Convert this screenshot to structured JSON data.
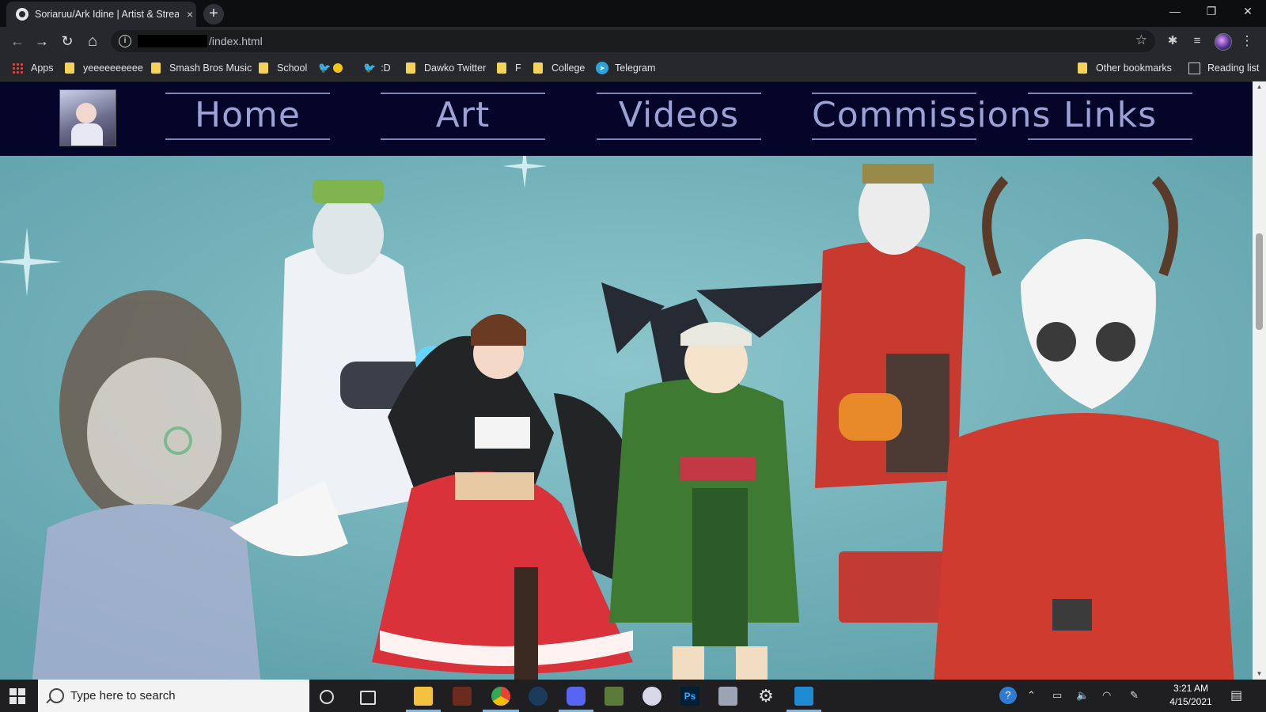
{
  "browser": {
    "tab_title": "Soriaruu/Ark Idine | Artist & Strea",
    "tab_close": "×",
    "new_tab": "+",
    "url_path": "/index.html",
    "window_controls": {
      "minimize": "—",
      "restore": "❐",
      "close": "✕"
    },
    "nav_icons": {
      "back": "←",
      "forward": "→",
      "reload": "↻",
      "home": "⌂",
      "bookmark_star": "☆",
      "extensions": "✱",
      "reading_queue": "≡",
      "menu": "⋮"
    }
  },
  "bookmarks": {
    "items": [
      {
        "label": "Apps",
        "icon": "apps-grid-icon"
      },
      {
        "label": "yeeeeeeeeee",
        "icon": "folder-icon"
      },
      {
        "label": "Smash Bros Music",
        "icon": "folder-icon"
      },
      {
        "label": "School",
        "icon": "folder-icon"
      },
      {
        "label": "",
        "icon": "twitter-icon"
      },
      {
        "label": ":D",
        "icon": "twitter-icon"
      },
      {
        "label": "Dawko Twitter",
        "icon": "folder-icon"
      },
      {
        "label": "F",
        "icon": "folder-icon"
      },
      {
        "label": "College",
        "icon": "folder-icon"
      },
      {
        "label": "Telegram",
        "icon": "telegram-icon"
      }
    ],
    "other": "Other bookmarks",
    "reading_list": "Reading list"
  },
  "site": {
    "nav": [
      "Home",
      "Art",
      "Videos",
      "Commissions",
      "Links"
    ],
    "hero_background": "#75b3bb",
    "nav_background": "#05052a",
    "nav_text_color": "#9da2d6"
  },
  "taskbar": {
    "search_placeholder": "Type here to search",
    "time": "3:21 AM",
    "date": "4/15/2021"
  }
}
